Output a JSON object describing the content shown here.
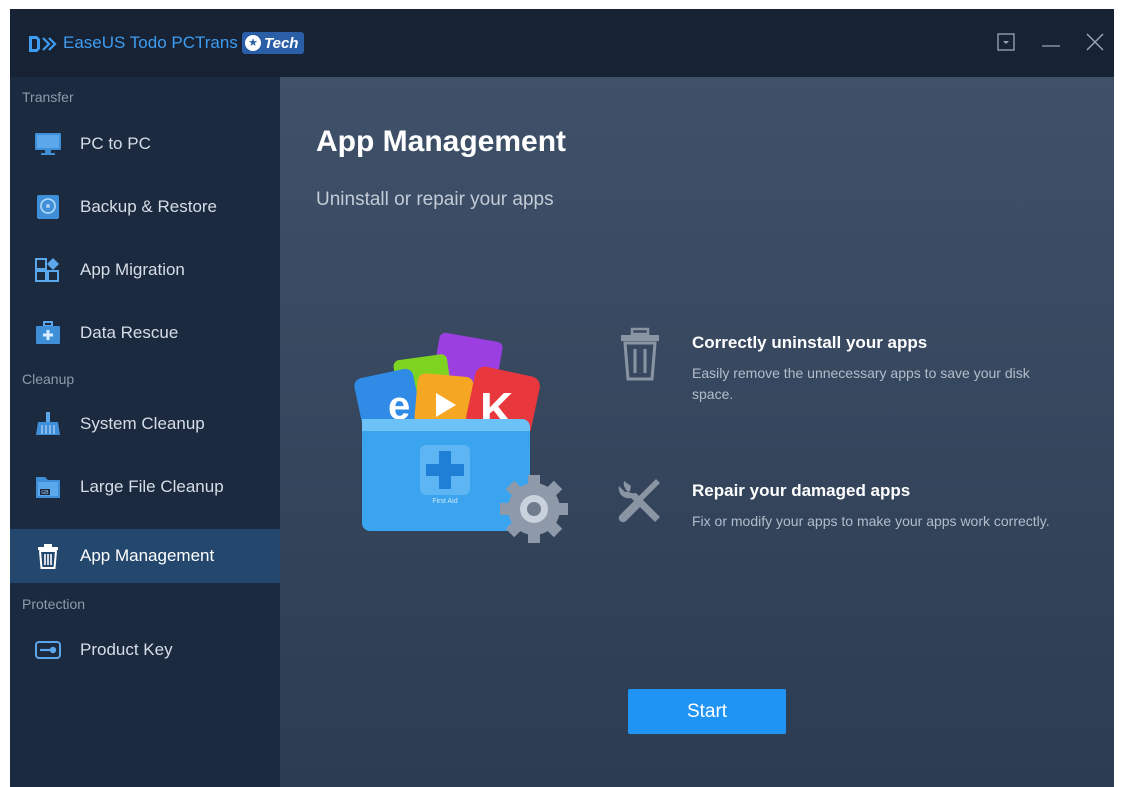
{
  "window": {
    "app_name": "EaseUS Todo PCTrans",
    "badge": "Tech",
    "controls": [
      "dropdown-icon",
      "minimize-icon",
      "close-icon"
    ]
  },
  "sidebar": {
    "sections": [
      {
        "label": "Transfer"
      },
      {
        "label": "Cleanup"
      },
      {
        "label": "Protection"
      }
    ],
    "items": [
      {
        "label": "PC to PC",
        "icon": "monitor-icon"
      },
      {
        "label": "Backup & Restore",
        "icon": "backup-disk-icon"
      },
      {
        "label": "App Migration",
        "icon": "app-grid-icon"
      },
      {
        "label": "Data Rescue",
        "icon": "first-aid-kit-icon"
      },
      {
        "label": "System Cleanup",
        "icon": "broom-icon"
      },
      {
        "label": "Large File Cleanup",
        "icon": "gb-folder-icon"
      },
      {
        "label": "App Management",
        "icon": "trash-can-icon",
        "active": true
      },
      {
        "label": "Product Key",
        "icon": "key-icon"
      }
    ]
  },
  "main": {
    "title": "App Management",
    "subtitle": "Uninstall or repair your apps",
    "hero_label": "First Aid",
    "features": [
      {
        "title": "Correctly uninstall your apps",
        "description": "Easily remove the unnecessary apps to save your disk space.",
        "icon": "trash-can-icon"
      },
      {
        "title": "Repair your damaged apps",
        "description": "Fix or modify your apps to make your apps work correctly.",
        "icon": "wrench-screwdriver-icon"
      }
    ],
    "start_label": "Start"
  },
  "colors": {
    "accent": "#1f94f5",
    "brand_text": "#3e9cf0",
    "sidebar_bg": "#1b2a3e",
    "active_item_bg": "#24476d",
    "titlebar_bg": "#172335"
  }
}
